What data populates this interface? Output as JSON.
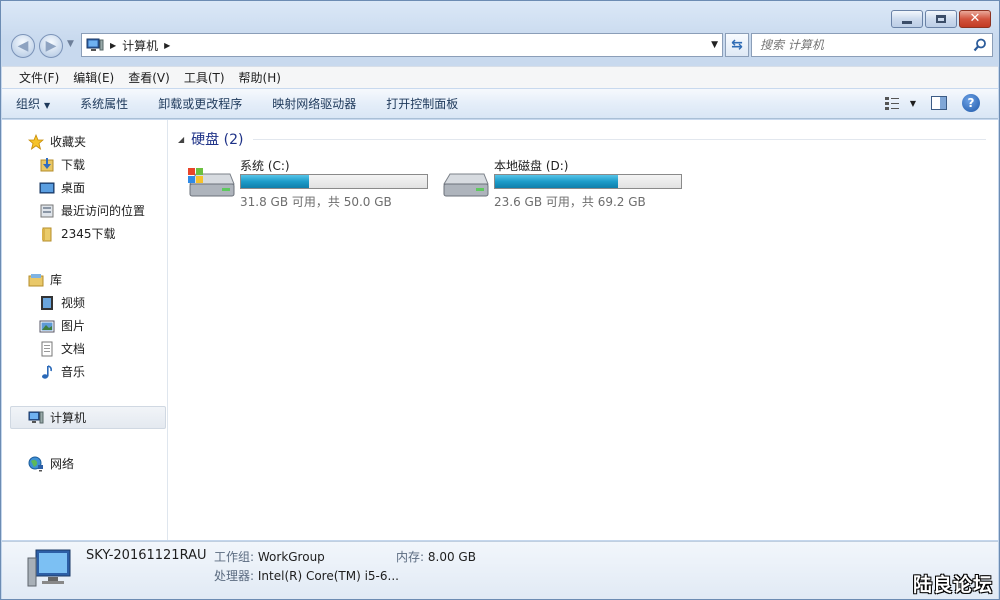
{
  "address": {
    "crumbs": [
      "计算机"
    ]
  },
  "search": {
    "placeholder": "搜索 计算机"
  },
  "menu": [
    {
      "label": "文件(F)"
    },
    {
      "label": "编辑(E)"
    },
    {
      "label": "查看(V)"
    },
    {
      "label": "工具(T)"
    },
    {
      "label": "帮助(H)"
    }
  ],
  "toolbar": {
    "organize": "组织",
    "items": [
      "系统属性",
      "卸载或更改程序",
      "映射网络驱动器",
      "打开控制面板"
    ]
  },
  "sidebar": {
    "favorites": {
      "label": "收藏夹",
      "items": [
        "下载",
        "桌面",
        "最近访问的位置",
        "2345下载"
      ]
    },
    "library": {
      "label": "库",
      "items": [
        "视频",
        "图片",
        "文档",
        "音乐"
      ]
    },
    "computer": "计算机",
    "network": "网络"
  },
  "main": {
    "group_label": "硬盘 (2)",
    "drives": [
      {
        "name": "系统 (C:)",
        "free_text": "31.8 GB 可用，共 50.0 GB",
        "used_fraction": 0.364
      },
      {
        "name": "本地磁盘 (D:)",
        "free_text": "23.6 GB 可用，共 69.2 GB",
        "used_fraction": 0.659
      }
    ]
  },
  "details": {
    "computer_name": "SKY-20161121RAU",
    "workgroup_label": "工作组:",
    "workgroup": "WorkGroup",
    "memory_label": "内存:",
    "memory": "8.00 GB",
    "cpu_label": "处理器:",
    "cpu": "Intel(R) Core(TM) i5-6..."
  },
  "watermark": "陆良论坛",
  "colors": {
    "accent": "#1e3287",
    "bar_fill": "#1c9cc9"
  }
}
